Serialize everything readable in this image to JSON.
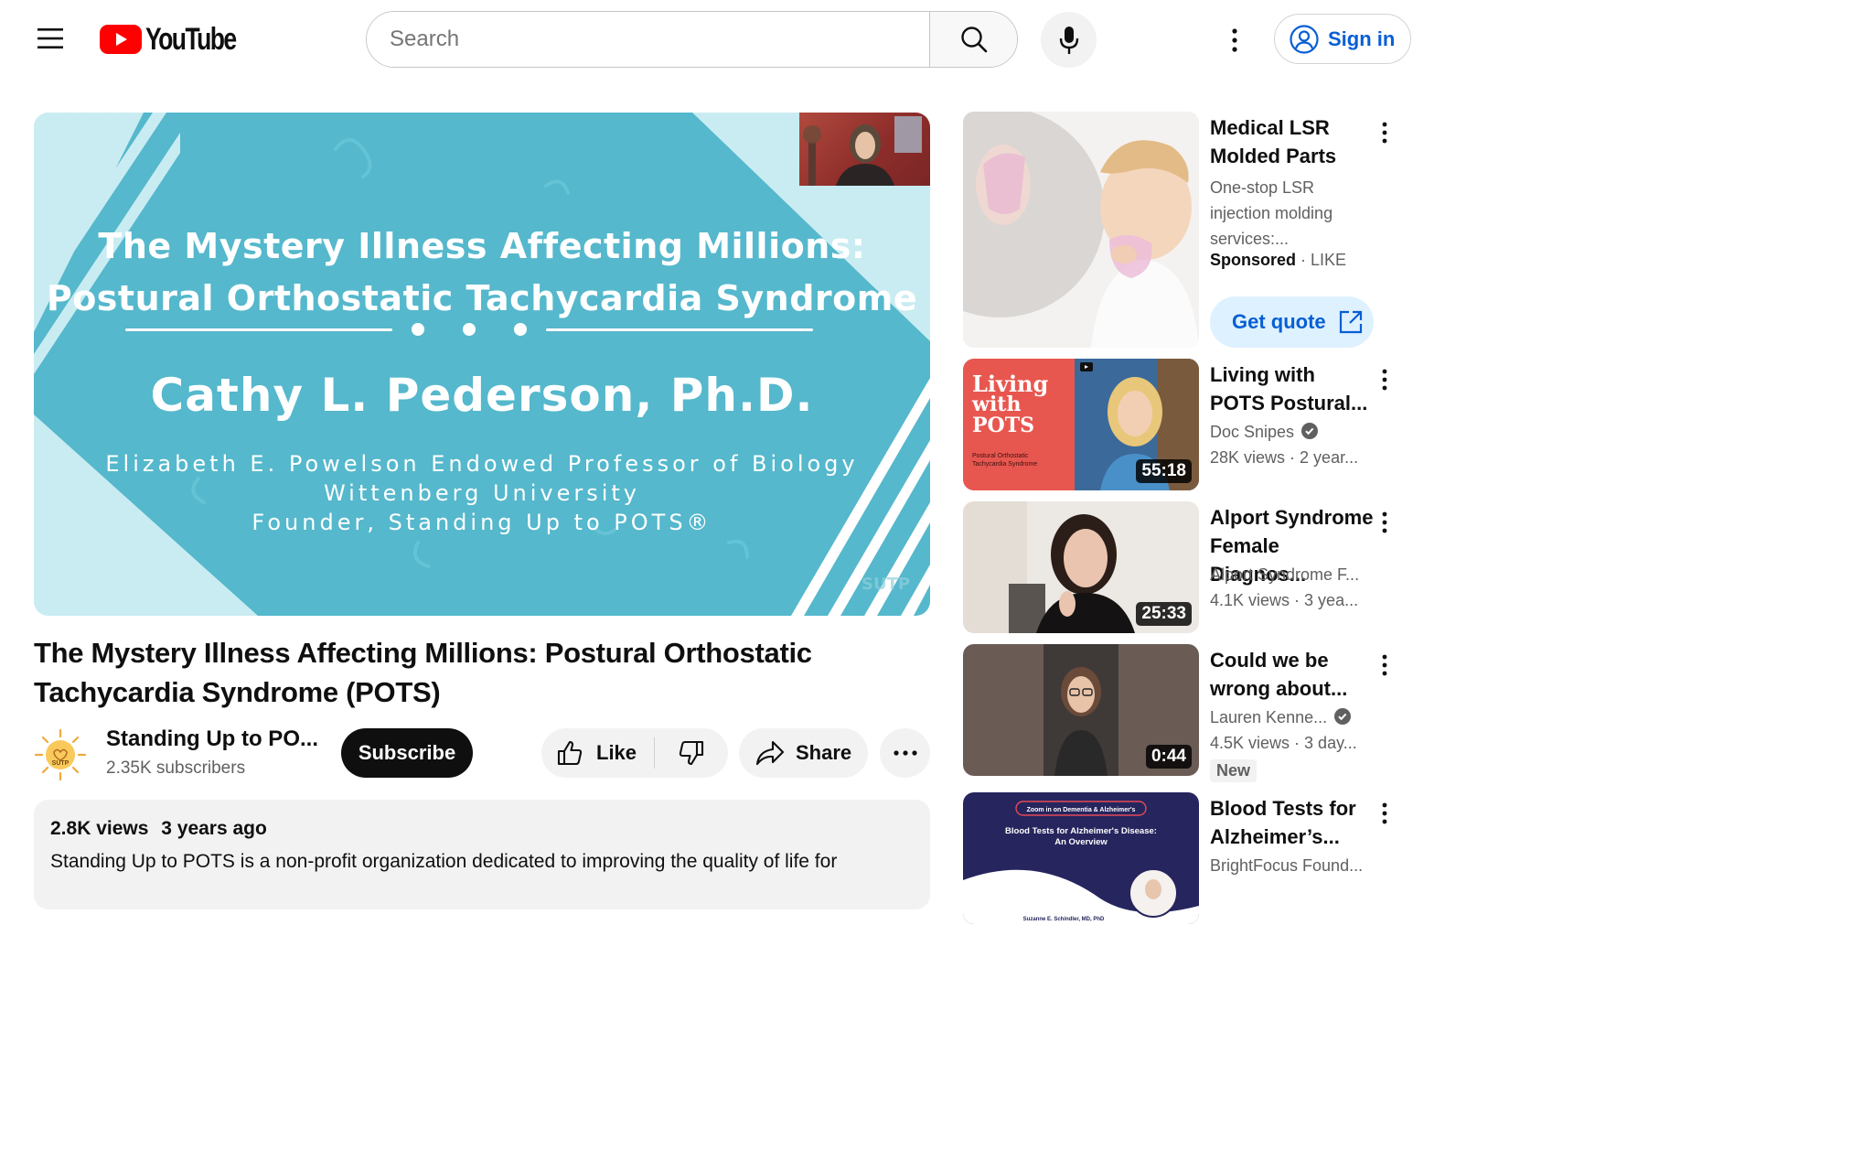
{
  "header": {
    "logo_text": "YouTube",
    "search_placeholder": "Search",
    "sign_in_label": "Sign in"
  },
  "player": {
    "slide_title_line1": "The Mystery Illness Affecting Millions:",
    "slide_title_line2": "Postural Orthostatic Tachycardia Syndrome",
    "slide_name": "Cathy L. Pederson, Ph.D.",
    "slide_sub_line1": "Elizabeth E. Powelson Endowed Professor of Biology",
    "slide_sub_line2": "Wittenberg University",
    "slide_sub_line3": "Founder, Standing Up to POTS®",
    "watermark": "SUTP",
    "colors": {
      "primary": "#55b8cc",
      "light": "#c9ecf2"
    }
  },
  "video": {
    "title": "The Mystery Illness Affecting Millions: Postural Orthostatic Tachycardia Syndrome (POTS)",
    "channel_name": "Standing Up to PO...",
    "channel_avatar_text": "SUTP",
    "subscribers": "2.35K subscribers",
    "subscribe_label": "Subscribe",
    "like_label": "Like",
    "share_label": "Share",
    "views": "2.8K views",
    "age": "3 years ago",
    "description": "Standing Up to POTS is a non-profit organization dedicated to improving the quality of life for"
  },
  "sidebar": {
    "ad": {
      "title": "Medical LSR Molded Parts",
      "description": "One-stop LSR injection molding services:...",
      "sponsored_label": "Sponsored",
      "sponsor": "LIKE",
      "cta_label": "Get quote"
    },
    "videos": [
      {
        "title": "Living with POTS Postural...",
        "channel": "Doc Snipes",
        "verified": true,
        "views": "28K views",
        "age": "2 year...",
        "duration": "55:18",
        "thumb_text_1": "Living",
        "thumb_text_2": "with",
        "thumb_text_3": "POTS",
        "thumb_caption_1": "Postural Orthostatic",
        "thumb_caption_2": "Tachycardia Syndrome"
      },
      {
        "title": "Alport Syndrome Female Diagnos...",
        "channel": "Alport Syndrome F...",
        "verified": false,
        "views": "4.1K views",
        "age": "3 yea...",
        "duration": "25:33"
      },
      {
        "title": "Could we be wrong about...",
        "channel": "Lauren Kenne...",
        "verified": true,
        "views": "4.5K views",
        "age": "3 day...",
        "duration": "0:44",
        "badge": "New"
      },
      {
        "title": "Blood Tests for Alzheimer’s...",
        "channel": "BrightFocus Found...",
        "verified": false,
        "thumb_tag": "Zoom in on Dementia & Alzheimer's",
        "thumb_title_1": "Blood Tests for Alzheimer's Disease:",
        "thumb_title_2": "An Overview",
        "thumb_presenter": "Suzanne E. Schindler, MD, PhD"
      }
    ]
  }
}
